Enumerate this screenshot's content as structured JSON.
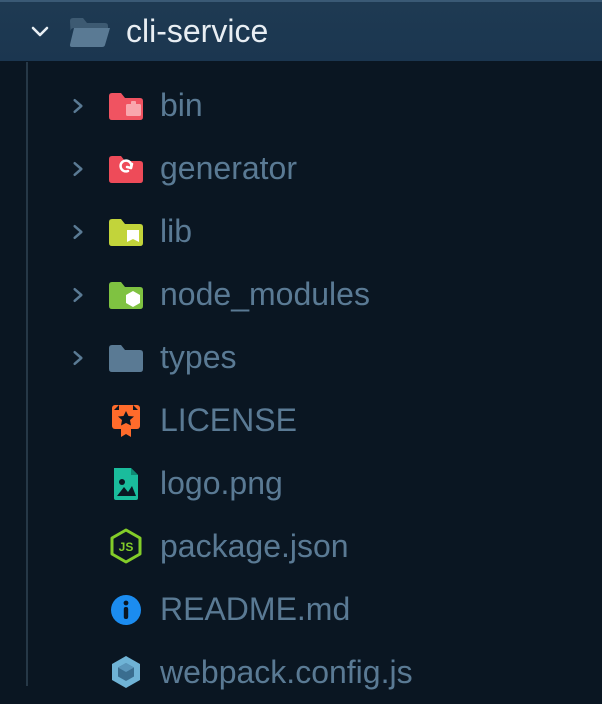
{
  "root": {
    "name": "cli-service",
    "expanded": true
  },
  "items": [
    {
      "name": "bin",
      "kind": "folder",
      "icon": "folder-bin",
      "expandable": true
    },
    {
      "name": "generator",
      "kind": "folder",
      "icon": "folder-gen",
      "expandable": true
    },
    {
      "name": "lib",
      "kind": "folder",
      "icon": "folder-lib",
      "expandable": true
    },
    {
      "name": "node_modules",
      "kind": "folder",
      "icon": "folder-node",
      "expandable": true
    },
    {
      "name": "types",
      "kind": "folder",
      "icon": "folder-plain",
      "expandable": true
    },
    {
      "name": "LICENSE",
      "kind": "file",
      "icon": "license",
      "expandable": false
    },
    {
      "name": "logo.png",
      "kind": "file",
      "icon": "image",
      "expandable": false
    },
    {
      "name": "package.json",
      "kind": "file",
      "icon": "nodejs",
      "expandable": false
    },
    {
      "name": "README.md",
      "kind": "file",
      "icon": "info",
      "expandable": false
    },
    {
      "name": "webpack.config.js",
      "kind": "file",
      "icon": "webpack",
      "expandable": false
    }
  ],
  "colors": {
    "folder_bin": "#f05361",
    "folder_bin_light": "#f9a6ad",
    "folder_gen": "#ee4b59",
    "folder_lib": "#c2d43a",
    "folder_node": "#7fc241",
    "folder_plain": "#5a7a94",
    "license": "#ff6b2b",
    "image": "#1abc9c",
    "nodejs": "#83cd29",
    "info": "#1b8cf0",
    "webpack": "#6fb3d6"
  }
}
